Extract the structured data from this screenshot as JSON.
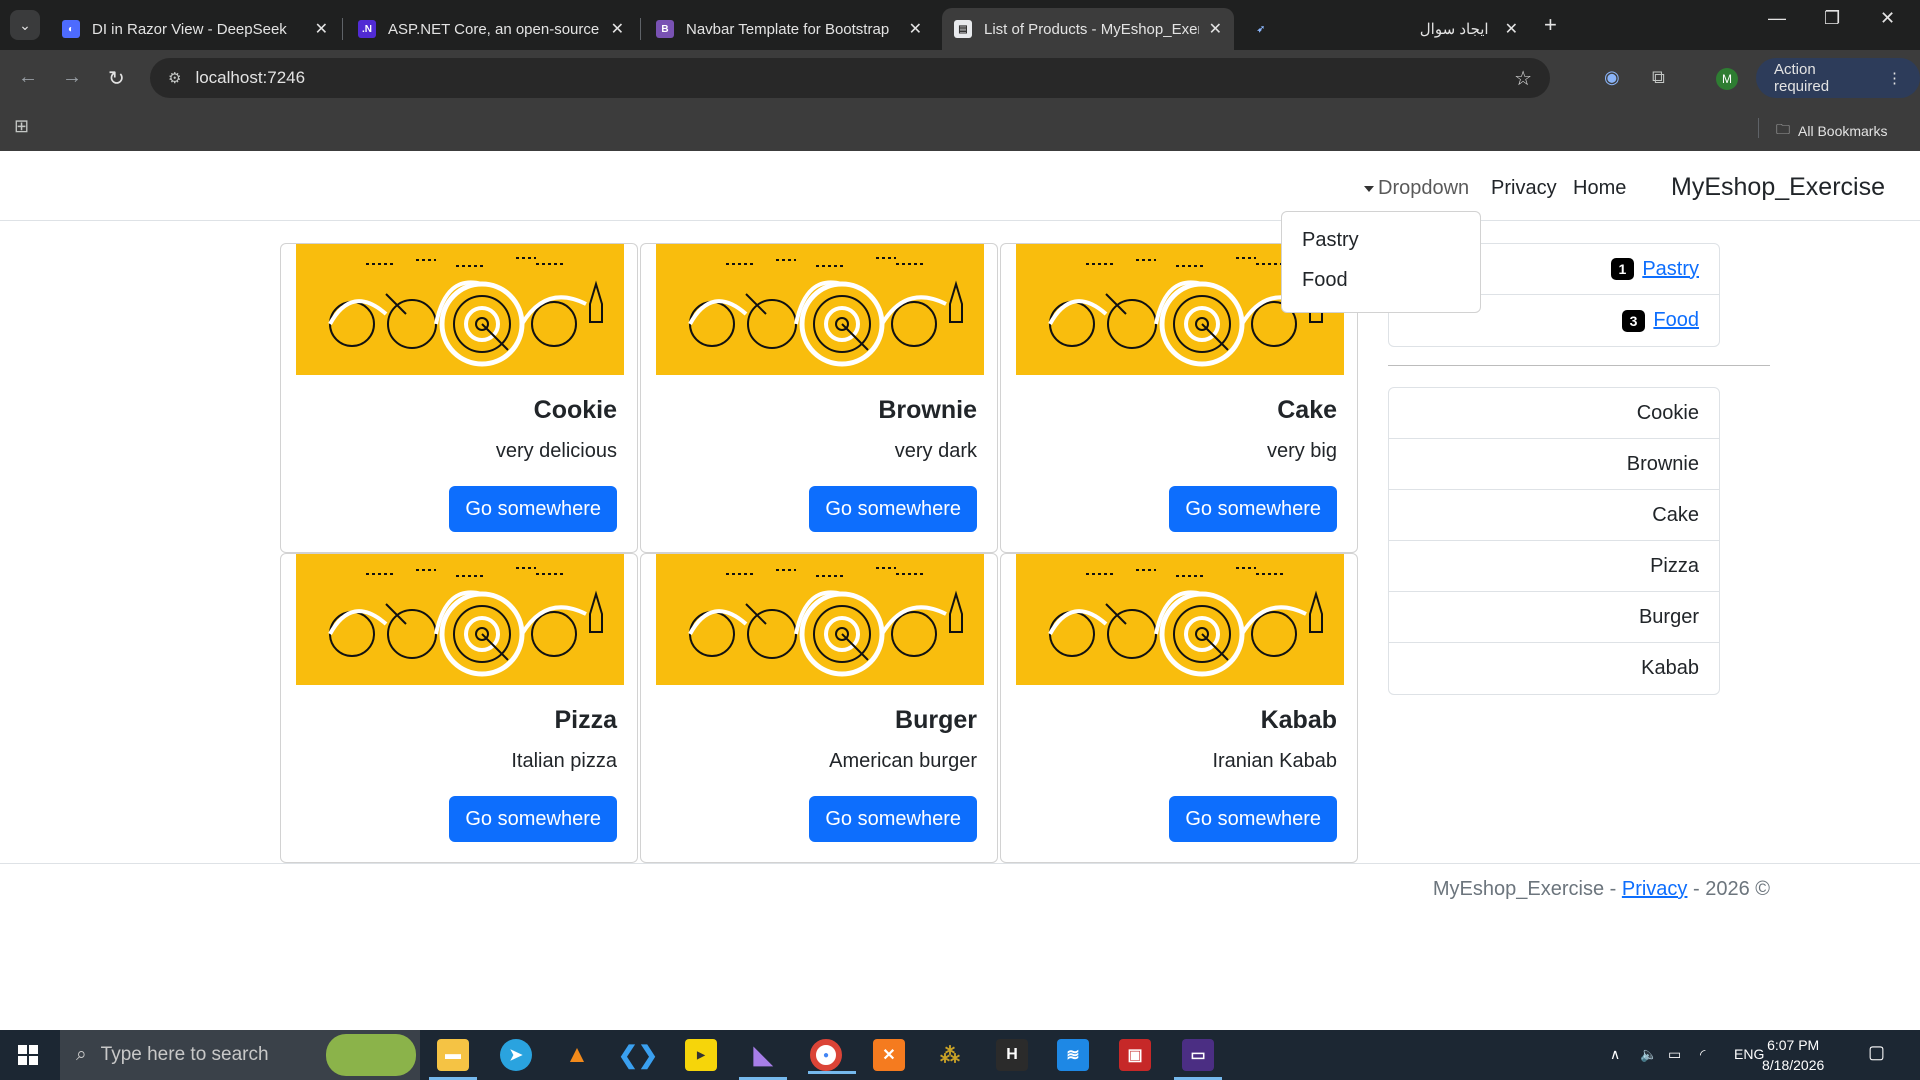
{
  "browser": {
    "tabs": [
      {
        "title": "DI in Razor View - DeepSeek",
        "icon": "deepseek-icon",
        "active": false
      },
      {
        "title": "ASP.NET Core, an open-source w",
        "icon": "dotnet-icon",
        "active": false
      },
      {
        "title": "Navbar Template for Bootstrap",
        "icon": "bootstrap-icon",
        "active": false
      },
      {
        "title": "List of Products - MyEshop_Exer",
        "icon": "page-icon",
        "active": true
      },
      {
        "title": "ایجاد سوال",
        "icon": "bird-icon",
        "active": false
      }
    ],
    "address": "localhost:7246",
    "profile_initial": "M",
    "action_required": "Action required",
    "all_bookmarks": "All Bookmarks"
  },
  "navbar": {
    "brand": "MyEshop_Exercise",
    "links": [
      "Home",
      "Privacy"
    ],
    "dropdown_label": "Dropdown",
    "dropdown_items": [
      "Pastry",
      "Food"
    ]
  },
  "products": [
    {
      "title": "Cake",
      "text": "very big",
      "button": "Go somewhere"
    },
    {
      "title": "Brownie",
      "text": "very dark",
      "button": "Go somewhere"
    },
    {
      "title": "Cookie",
      "text": "very delicious",
      "button": "Go somewhere"
    },
    {
      "title": "Kabab",
      "text": "Iranian Kabab",
      "button": "Go somewhere"
    },
    {
      "title": "Burger",
      "text": "American burger",
      "button": "Go somewhere"
    },
    {
      "title": "Pizza",
      "text": "Italian pizza",
      "button": "Go somewhere"
    }
  ],
  "categories": [
    {
      "name": "Pastry",
      "count": "1"
    },
    {
      "name": "Food",
      "count": "3"
    }
  ],
  "product_list": [
    "Cookie",
    "Brownie",
    "Cake",
    "Pizza",
    "Burger",
    "Kabab"
  ],
  "footer": {
    "brand": "MyEshop_Exercise",
    "sep1": " - ",
    "privacy": "Privacy",
    "year": " - 2026 ©"
  },
  "taskbar": {
    "search_placeholder": "Type here to search",
    "language": "ENG",
    "time": "6:07 PM",
    "date": "8/18/2026"
  },
  "colors": {
    "primary": "#0d6efd",
    "card_image": "#f9bd0d",
    "badge": "#000000"
  }
}
